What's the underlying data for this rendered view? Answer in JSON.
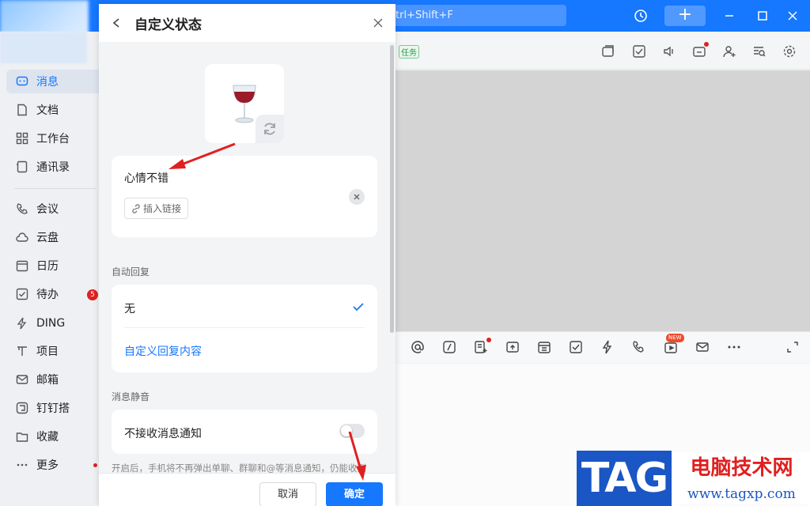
{
  "topbar": {
    "search_hint": "trl+Shift+F",
    "plus_label": "+"
  },
  "sidebar": {
    "items": [
      {
        "label": "消息"
      },
      {
        "label": "文档"
      },
      {
        "label": "工作台"
      },
      {
        "label": "通讯录"
      },
      {
        "label": "会议"
      },
      {
        "label": "云盘"
      },
      {
        "label": "日历"
      },
      {
        "label": "待办"
      },
      {
        "label": "DING"
      },
      {
        "label": "项目"
      },
      {
        "label": "邮箱"
      },
      {
        "label": "钉钉搭"
      },
      {
        "label": "收藏"
      },
      {
        "label": "更多"
      }
    ],
    "todo_badge": "5"
  },
  "chat": {
    "task_tag": "任务",
    "new_badge": "NEW"
  },
  "dialog": {
    "title": "自定义状态",
    "emoji": "🍷",
    "status_text": "心情不错",
    "insert_link": "插入链接",
    "auto_reply_label": "自动回复",
    "reply_none": "无",
    "custom_reply": "自定义回复内容",
    "mute_label": "消息静音",
    "mute_option": "不接收消息通知",
    "mute_hint": "开启后，手机将不再弹出单聊、群聊和@等消息通知，仍能收到",
    "cancel": "取消",
    "confirm": "确定"
  },
  "watermark": {
    "brand": "TAG",
    "cn": "电脑技术网",
    "url": "www.tagxp.com"
  },
  "colors": {
    "accent": "#1677ff",
    "badge": "#e02020"
  }
}
